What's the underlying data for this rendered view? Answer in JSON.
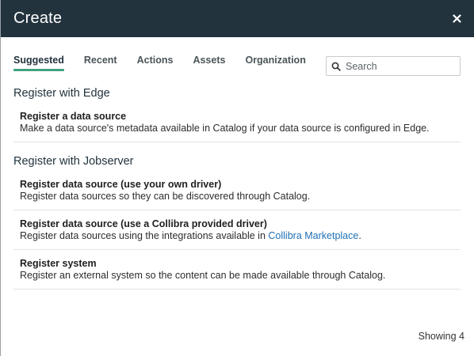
{
  "dialog": {
    "title": "Create",
    "close_icon": "close-icon"
  },
  "tabs": [
    {
      "label": "Suggested",
      "active": true
    },
    {
      "label": "Recent",
      "active": false
    },
    {
      "label": "Actions",
      "active": false
    },
    {
      "label": "Assets",
      "active": false
    },
    {
      "label": "Organization",
      "active": false
    }
  ],
  "search": {
    "placeholder": "Search",
    "icon": "search-icon"
  },
  "sections": [
    {
      "title": "Register with Edge",
      "items": [
        {
          "title": "Register a data source",
          "description": "Make a data source's metadata available in Catalog if your data source is configured in Edge."
        }
      ]
    },
    {
      "title": "Register with Jobserver",
      "items": [
        {
          "title": "Register data source (use your own driver)",
          "description": "Register data sources so they can be discovered through Catalog."
        },
        {
          "title": "Register data source (use a Collibra provided driver)",
          "description_prefix": "Register data sources using the integrations available in ",
          "description_link": "Collibra Marketplace",
          "description_suffix": "."
        },
        {
          "title": "Register system",
          "description": "Register an external system so the content can be made available through Catalog."
        }
      ]
    }
  ],
  "footer": {
    "count_text": "Showing 4"
  },
  "colors": {
    "header_bg": "#22333d",
    "active_tab_underline": "#3fa27e",
    "link": "#1f6fb5"
  }
}
